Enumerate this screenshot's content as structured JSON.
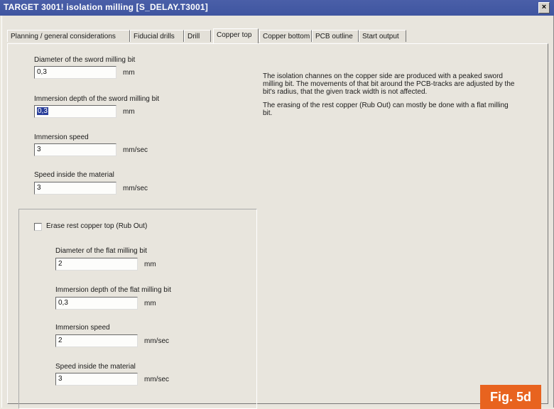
{
  "window": {
    "title": "TARGET 3001!  isolation milling  [S_DELAY.T3001]",
    "close_label": "×"
  },
  "tabs": [
    {
      "label": "Planning / general considerations"
    },
    {
      "label": "Fiducial drills"
    },
    {
      "label": "Drill"
    },
    {
      "label": "Copper top",
      "active": true
    },
    {
      "label": "Copper bottom"
    },
    {
      "label": "PCB outline"
    },
    {
      "label": "Start output"
    }
  ],
  "sword": {
    "diameter": {
      "label": "Diameter of the sword milling bit",
      "value": "0,3",
      "unit": "mm"
    },
    "depth": {
      "label": "Immersion depth of the sword milling bit",
      "value": "0,3",
      "unit": "mm"
    },
    "speed": {
      "label": "Immersion speed",
      "value": "3",
      "unit": "mm/sec"
    },
    "material_speed": {
      "label": "Speed inside the material",
      "value": "3",
      "unit": "mm/sec"
    }
  },
  "rubout": {
    "checkbox_label": "Erase rest copper top (Rub Out)",
    "checked": false,
    "diameter": {
      "label": "Diameter of the flat milling bit",
      "value": "2",
      "unit": "mm"
    },
    "depth": {
      "label": "Immersion depth of the flat milling bit",
      "value": "0,3",
      "unit": "mm"
    },
    "speed": {
      "label": "Immersion speed",
      "value": "2",
      "unit": "mm/sec"
    },
    "material_speed": {
      "label": "Speed inside the material",
      "value": "3",
      "unit": "mm/sec"
    }
  },
  "description": {
    "para1": "The isolation channes on the copper side are produced with a peaked sword milling bit. The movements of that bit around the PCB-tracks are adjusted by the bit's radius, that the given track width is not affected.",
    "para2": "The erasing of the rest copper (Rub Out) can mostly be done with a flat milling bit."
  },
  "figure_label": "Fig. 5d",
  "colors": {
    "title_bar": "#4a5fa8",
    "figure_badge": "#e8631f"
  }
}
